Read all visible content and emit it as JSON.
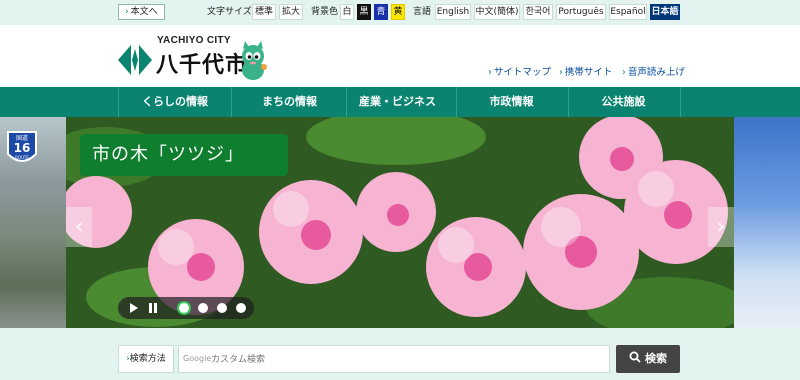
{
  "topbar": {
    "skip_label": "本文へ",
    "font_size_label": "文字サイズ",
    "font_standard": "標準",
    "font_large": "拡大",
    "bg_color_label": "背景色",
    "bg_white": "白",
    "bg_black": "黒",
    "bg_blue": "青",
    "bg_yellow": "黄",
    "language_label": "言語",
    "languages": [
      "English",
      "中文(簡体)",
      "한국어",
      "Português",
      "Español",
      "日本語"
    ],
    "active_language": "日本語"
  },
  "header": {
    "logo_sub": "YACHIYO CITY",
    "logo_main": "八千代市",
    "links": [
      "サイトマップ",
      "携帯サイト",
      "音声読み上げ"
    ]
  },
  "nav": {
    "items": [
      "くらしの情報",
      "まちの情報",
      "産業・ビジネス",
      "市政情報",
      "公共施設"
    ]
  },
  "hero": {
    "caption": "市の木「ツツジ」",
    "route_sign_top": "国道",
    "route_sign_number": "16",
    "route_sign_bottom": "ROUTE",
    "slide_count": 4,
    "active_slide": 1
  },
  "search": {
    "method_label": "検索方法",
    "engine_label": "Google",
    "placeholder": "カスタム検索",
    "button_label": "検索"
  },
  "colors": {
    "brand_green": "#0a8470",
    "topbar_bg": "#e3f3ef",
    "caption_green": "#0f7e2e",
    "link_blue": "#0a4f9e",
    "active_lang_bg": "#00387a"
  }
}
